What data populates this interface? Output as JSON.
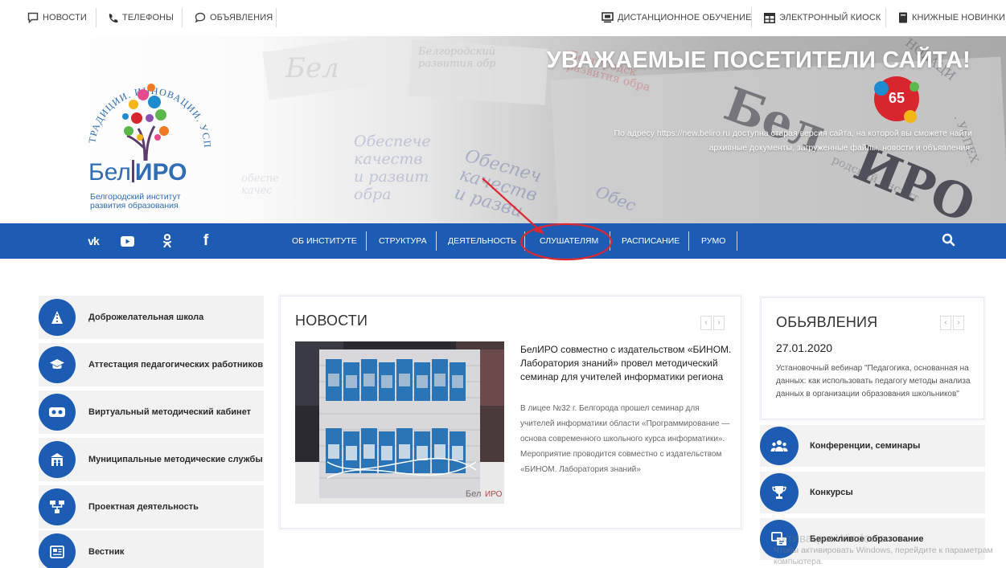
{
  "topbar": {
    "left_links": [
      {
        "label": "НОВОСТИ",
        "icon": "chat-square-icon"
      },
      {
        "label": "ТЕЛЕФОНЫ",
        "icon": "phone-icon"
      },
      {
        "label": "ОБЪЯВЛЕНИЯ",
        "icon": "chat-bubble-icon"
      }
    ],
    "right_links": [
      {
        "label": "ДИСТАНЦИОННОЕ ОБУЧЕНИЕ",
        "icon": "monitor-icon"
      },
      {
        "label": "ЭЛЕКТРОННЫЙ КИОСК",
        "icon": "kiosk-grid-icon"
      },
      {
        "label": "КНИЖНЫЕ НОВИНКИ",
        "icon": "book-icon"
      }
    ]
  },
  "banner": {
    "title": "УВАЖАЕМЫЕ ПОСЕТИТЕЛИ САЙТА!",
    "text_line1": "По адресу https://new.beliro.ru доступна старая версия сайта, на которой вы сможете найти",
    "text_line2": "архивные документы, загруженные файлы, новости и объявления.",
    "logo": {
      "arc_text": "ТРАДИЦИИ. ИННОВАЦИИ. УСПЕХ",
      "name_left": "Бел",
      "name_right": "ИРО",
      "subtitle": "Белгородский институт развития образования"
    }
  },
  "nav": {
    "social": [
      "vk-icon",
      "youtube-icon",
      "odnoklassniki-icon",
      "facebook-icon"
    ],
    "items": [
      {
        "label": "ОБ ИНСТИТУТЕ"
      },
      {
        "label": "СТРУКТУРА"
      },
      {
        "label": "ДЕЯТЕЛЬНОСТЬ"
      },
      {
        "label": "СЛУШАТЕЛЯМ"
      },
      {
        "label": "РАСПИСАНИЕ"
      },
      {
        "label": "РУМО"
      }
    ],
    "highlight_color": "#e0262f",
    "accent_color": "#1d5cb3"
  },
  "left_menu": [
    {
      "label": "Доброжелательная школа",
      "icon": "school-road-icon"
    },
    {
      "label": "Аттестация педагогических работников",
      "icon": "graduation-cap-icon"
    },
    {
      "label": "Виртуальный методический кабинет",
      "icon": "vr-headset-icon"
    },
    {
      "label": "Муниципальные методические службы",
      "icon": "building-people-icon"
    },
    {
      "label": "Проектная деятельность",
      "icon": "project-network-icon"
    },
    {
      "label": "Вестник",
      "icon": "newspaper-icon"
    }
  ],
  "news": {
    "title": "НОВОСТИ",
    "prev": "‹",
    "next": "›",
    "headline": "БелИРО совместно с издательством «БИНОМ. Лаборатория знаний» провел методический семинар для учителей информатики региона",
    "text": "В лицее №32 г. Белгорода прошел семинар для учителей информатики области «Программирование — основа современного школьного курса информатики». Мероприятие проводится совместно с издательством «БИНОМ. Лаборатория знаний»"
  },
  "announcements": {
    "title": "ОБЬЯВЛЕНИЯ",
    "prev": "‹",
    "next": "›",
    "date": "27.01.2020",
    "text": "Установочный вебинар \"Педагогика, основанная на данных: как использовать педагогу методы анализа данных в организации образования школьников\""
  },
  "right_menu": [
    {
      "label": "Конференции, семинары",
      "icon": "group-people-icon"
    },
    {
      "label": "Конкурсы",
      "icon": "trophy-icon"
    },
    {
      "label": "Бережливое образование",
      "icon": "process-icon"
    }
  ],
  "watermark": {
    "line1": "Активация Windows",
    "line2": "Чтобы активировать Windows, перейдите к параметрам компьютера."
  }
}
